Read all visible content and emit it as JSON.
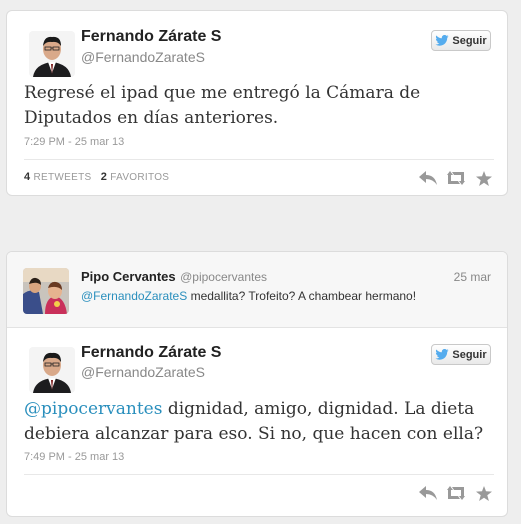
{
  "tweet1": {
    "author_name": "Fernando Zárate S",
    "author_handle": "@FernandoZarateS",
    "follow_label": "Seguir",
    "text": "Regresé el ipad que me entregó la Cámara de Diputados en días anteriores.",
    "timestamp": "7:29 PM - 25 mar 13",
    "retweets_count": "4",
    "retweets_label": "RETWEETS",
    "favorites_count": "2",
    "favorites_label": "FAVORITOS"
  },
  "tweet2": {
    "reply": {
      "author_name": "Pipo Cervantes",
      "author_handle": "@pipocervantes",
      "date": "25 mar",
      "mention": "@FernandoZarateS",
      "text": " medallita? Trofeito? A chambear hermano!"
    },
    "author_name": "Fernando Zárate S",
    "author_handle": "@FernandoZarateS",
    "follow_label": "Seguir",
    "mention": "@pipocervantes",
    "text": " dignidad, amigo, dignidad. La dieta debiera alcanzar para eso. Si no, que hacen con ella?",
    "timestamp": "7:49 PM - 25 mar 13"
  },
  "icons": [
    "twitter-bird-icon",
    "reply-icon",
    "retweet-icon",
    "favorite-star-icon"
  ],
  "colors": {
    "mention": "#2a8fbd",
    "twitter_blue": "#55acee",
    "background": "#eeeeee"
  }
}
